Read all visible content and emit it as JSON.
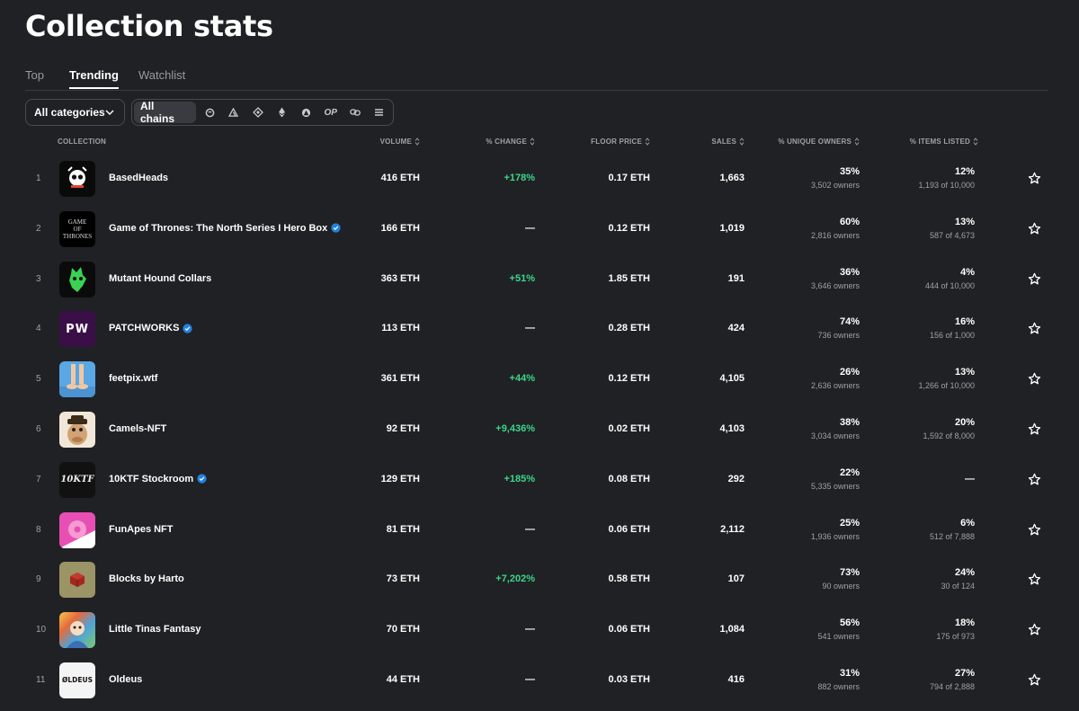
{
  "page": {
    "title": "Collection stats"
  },
  "tabs": [
    {
      "label": "Top",
      "active": false
    },
    {
      "label": "Trending",
      "active": true
    },
    {
      "label": "Watchlist",
      "active": false
    }
  ],
  "filters": {
    "category_label": "All categories",
    "chains_all_label": "All chains",
    "chain_icons": [
      "solana-icon",
      "arbitrum-icon",
      "bnb-icon",
      "ethereum-icon",
      "avalanche-icon",
      "optimism-icon",
      "chain-link-icon",
      "menu-lines-icon"
    ],
    "op_label": "OP"
  },
  "columns": {
    "collection": "COLLECTION",
    "volume": "VOLUME",
    "change": "% CHANGE",
    "floor": "FLOOR PRICE",
    "sales": "SALES",
    "owners": "% UNIQUE OWNERS",
    "listed": "% ITEMS LISTED"
  },
  "colors": {
    "background": "#202124",
    "positive": "#3dd68c",
    "verified": "#2081e2"
  },
  "rows": [
    {
      "rank": "1",
      "name": "BasedHeads",
      "verified": false,
      "volume": "416 ETH",
      "change": "+178%",
      "change_positive": true,
      "floor": "0.17 ETH",
      "sales": "1,663",
      "owners_pct": "35%",
      "owners_sub": "3,502 owners",
      "listed_pct": "12%",
      "listed_sub": "1,193 of 10,000",
      "thumb": "skull-icon"
    },
    {
      "rank": "2",
      "name": "Game of Thrones: The North Series I Hero Box",
      "verified": true,
      "volume": "166 ETH",
      "change": "—",
      "change_positive": false,
      "floor": "0.12 ETH",
      "sales": "1,019",
      "owners_pct": "60%",
      "owners_sub": "2,816 owners",
      "listed_pct": "13%",
      "listed_sub": "587 of 4,673",
      "thumb": "got-logo-icon"
    },
    {
      "rank": "3",
      "name": "Mutant Hound Collars",
      "verified": false,
      "volume": "363 ETH",
      "change": "+51%",
      "change_positive": true,
      "floor": "1.85 ETH",
      "sales": "191",
      "owners_pct": "36%",
      "owners_sub": "3,646 owners",
      "listed_pct": "4%",
      "listed_sub": "444 of 10,000",
      "thumb": "hound-icon"
    },
    {
      "rank": "4",
      "name": "PATCHWORKS",
      "verified": true,
      "volume": "113 ETH",
      "change": "—",
      "change_positive": false,
      "floor": "0.28 ETH",
      "sales": "424",
      "owners_pct": "74%",
      "owners_sub": "736 owners",
      "listed_pct": "16%",
      "listed_sub": "156 of 1,000",
      "thumb": "pw-logo-icon",
      "thumb_text": "PW"
    },
    {
      "rank": "5",
      "name": "feetpix.wtf",
      "verified": false,
      "volume": "361 ETH",
      "change": "+44%",
      "change_positive": true,
      "floor": "0.12 ETH",
      "sales": "4,105",
      "owners_pct": "26%",
      "owners_sub": "2,636 owners",
      "listed_pct": "13%",
      "listed_sub": "1,266 of 10,000",
      "thumb": "feet-icon"
    },
    {
      "rank": "6",
      "name": "Camels-NFT",
      "verified": false,
      "volume": "92 ETH",
      "change": "+9,436%",
      "change_positive": true,
      "floor": "0.02 ETH",
      "sales": "4,103",
      "owners_pct": "38%",
      "owners_sub": "3,034 owners",
      "listed_pct": "20%",
      "listed_sub": "1,592 of 8,000",
      "thumb": "camel-icon"
    },
    {
      "rank": "7",
      "name": "10KTF Stockroom",
      "verified": true,
      "volume": "129 ETH",
      "change": "+185%",
      "change_positive": true,
      "floor": "0.08 ETH",
      "sales": "292",
      "owners_pct": "22%",
      "owners_sub": "5,335 owners",
      "listed_pct": "—",
      "listed_sub": "",
      "thumb": "10ktf-logo-icon",
      "thumb_text": "10KTF"
    },
    {
      "rank": "8",
      "name": "FunApes NFT",
      "verified": false,
      "volume": "81 ETH",
      "change": "—",
      "change_positive": false,
      "floor": "0.06 ETH",
      "sales": "2,112",
      "owners_pct": "25%",
      "owners_sub": "1,936 owners",
      "listed_pct": "6%",
      "listed_sub": "512 of 7,888",
      "thumb": "donut-icon"
    },
    {
      "rank": "9",
      "name": "Blocks by Harto",
      "verified": false,
      "volume": "73 ETH",
      "change": "+7,202%",
      "change_positive": true,
      "floor": "0.58 ETH",
      "sales": "107",
      "owners_pct": "73%",
      "owners_sub": "90 owners",
      "listed_pct": "24%",
      "listed_sub": "30 of 124",
      "thumb": "cube-icon"
    },
    {
      "rank": "10",
      "name": "Little Tinas Fantasy",
      "verified": false,
      "volume": "70 ETH",
      "change": "—",
      "change_positive": false,
      "floor": "0.06 ETH",
      "sales": "1,084",
      "owners_pct": "56%",
      "owners_sub": "541 owners",
      "listed_pct": "18%",
      "listed_sub": "175 of 973",
      "thumb": "fantasy-art-icon"
    },
    {
      "rank": "11",
      "name": "Oldeus",
      "verified": false,
      "volume": "44 ETH",
      "change": "—",
      "change_positive": false,
      "floor": "0.03 ETH",
      "sales": "416",
      "owners_pct": "31%",
      "owners_sub": "882 owners",
      "listed_pct": "27%",
      "listed_sub": "794 of 2,888",
      "thumb": "oldeus-logo-icon",
      "thumb_text": "ØLDEUS"
    }
  ]
}
